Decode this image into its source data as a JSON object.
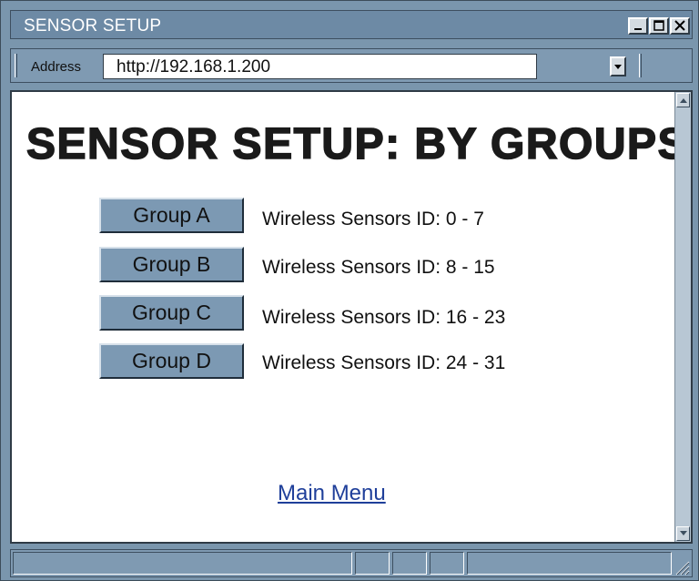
{
  "window": {
    "title": "SENSOR SETUP"
  },
  "address_bar": {
    "label": "Address",
    "url": "http://192.168.1.200"
  },
  "page": {
    "heading": "SENSOR SETUP: BY GROUPS",
    "groups": [
      {
        "label": "Group A",
        "description": "Wireless Sensors ID:  0 - 7"
      },
      {
        "label": "Group B",
        "description": "Wireless Sensors ID:  8 - 15"
      },
      {
        "label": "Group C",
        "description": "Wireless Sensors ID:  16 - 23"
      },
      {
        "label": "Group D",
        "description": "Wireless Sensors ID:  24 - 31"
      }
    ],
    "main_menu_link": "Main Menu"
  },
  "icons": {
    "minimize": "minimize-icon",
    "maximize": "maximize-icon",
    "close": "close-icon",
    "dropdown": "chevron-down-icon",
    "scroll_up": "arrow-up-icon",
    "scroll_down": "arrow-down-icon",
    "resize": "resize-grip-icon"
  },
  "colors": {
    "chrome": "#7a96ad",
    "button": "#7c99b3",
    "link": "#1f3f9a"
  }
}
